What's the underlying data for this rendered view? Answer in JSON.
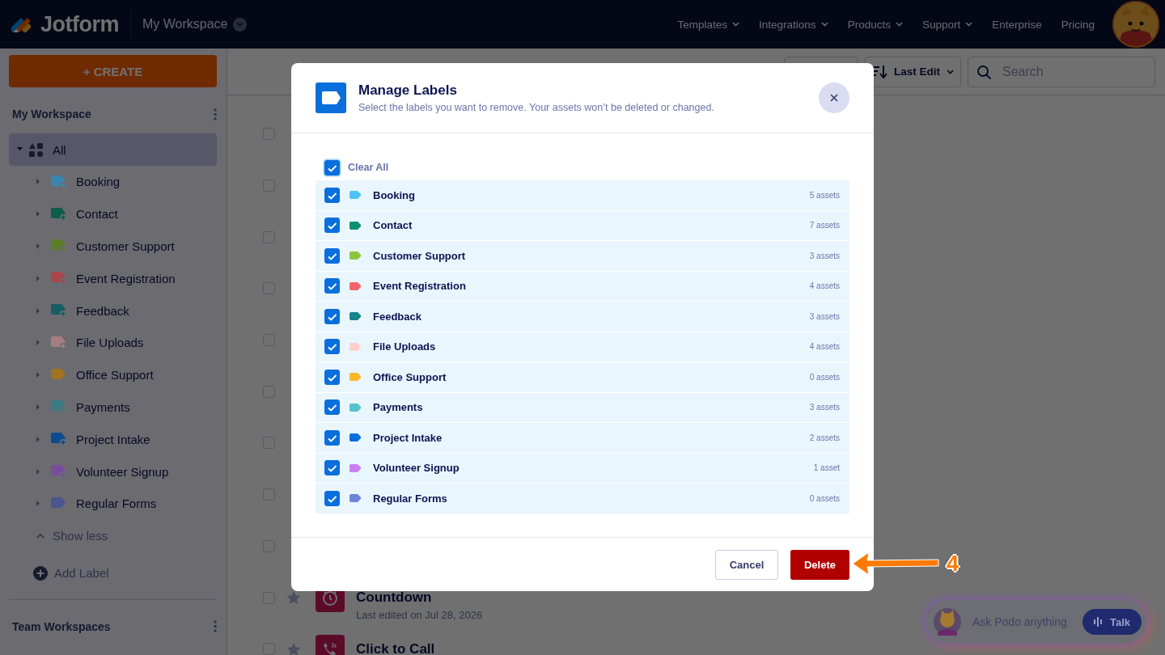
{
  "header": {
    "logo": "Jotform",
    "workspace": "My Workspace",
    "nav": [
      {
        "label": "Templates",
        "dropdown": true
      },
      {
        "label": "Integrations",
        "dropdown": true
      },
      {
        "label": "Products",
        "dropdown": true
      },
      {
        "label": "Support",
        "dropdown": true
      },
      {
        "label": "Enterprise",
        "dropdown": false
      },
      {
        "label": "Pricing",
        "dropdown": false
      }
    ]
  },
  "sidebar": {
    "create_button": "+ CREATE",
    "section_title": "My Workspace",
    "all_item": {
      "label": "All",
      "selected": true,
      "expanded": true
    },
    "labels": [
      {
        "name": "Booking",
        "color": "#3a86b0",
        "shared": true,
        "selected": false
      },
      {
        "name": "Contact",
        "color": "#0d5e48",
        "shared": true,
        "selected": false
      },
      {
        "name": "Customer Support",
        "color": "#5b7e26",
        "shared": true,
        "selected": false
      },
      {
        "name": "Event Registration",
        "color": "#a8464c",
        "shared": true,
        "selected": false
      },
      {
        "name": "Feedback",
        "color": "#155e62",
        "shared": true,
        "selected": false
      },
      {
        "name": "File Uploads",
        "color": "#a37e80",
        "shared": true,
        "selected": false
      },
      {
        "name": "Office Support",
        "color": "#9e7420",
        "shared": false,
        "selected": false
      },
      {
        "name": "Payments",
        "color": "#3a7c82",
        "shared": true,
        "selected": false
      },
      {
        "name": "Project Intake",
        "color": "#0c4c8e",
        "shared": true,
        "selected": false
      },
      {
        "name": "Volunteer Signup",
        "color": "#7a4c9c",
        "shared": true,
        "selected": false
      },
      {
        "name": "Regular Forms",
        "color": "#4a5690",
        "shared": false,
        "selected": false
      }
    ],
    "show_less": "Show less",
    "add_label": "Add Label",
    "team_section_title": "Team Workspaces"
  },
  "toolbar": {
    "sort_button": "Last Edit",
    "search": {
      "placeholder": "Search"
    }
  },
  "forms": [
    {
      "checked": false
    },
    {
      "checked": false
    },
    {
      "checked": false
    },
    {
      "checked": false
    },
    {
      "checked": false
    },
    {
      "checked": false
    },
    {
      "checked": false
    },
    {
      "checked": false
    },
    {
      "checked": false
    },
    {
      "checked": false,
      "starred": false,
      "kind": "timer",
      "title": "Countdown",
      "subtitle": "Last edited on Jul 28, 2026"
    },
    {
      "checked": false,
      "starred": false,
      "kind": "phone",
      "title": "Click to Call"
    }
  ],
  "modal": {
    "title": "Manage Labels",
    "subtitle": "Select the labels you want to remove. Your assets won’t be deleted or changed.",
    "clear_all": {
      "label": "Clear All",
      "checked": true
    },
    "labels": [
      {
        "name": "Booking",
        "color": "#4fc3f7",
        "count": "5 assets",
        "checked": true
      },
      {
        "name": "Contact",
        "color": "#0f8f6c",
        "count": "7 assets",
        "checked": true
      },
      {
        "name": "Customer Support",
        "color": "#8cc63f",
        "count": "3 assets",
        "checked": true
      },
      {
        "name": "Event Registration",
        "color": "#f4646b",
        "count": "4 assets",
        "checked": true
      },
      {
        "name": "Feedback",
        "color": "#17858a",
        "count": "3 assets",
        "checked": true
      },
      {
        "name": "File Uploads",
        "color": "#fdd0cf",
        "count": "4 assets",
        "checked": true
      },
      {
        "name": "Office Support",
        "color": "#ffb629",
        "count": "0 assets",
        "checked": true
      },
      {
        "name": "Payments",
        "color": "#55c2cc",
        "count": "3 assets",
        "checked": true
      },
      {
        "name": "Project Intake",
        "color": "#0a6fdc",
        "count": "2 assets",
        "checked": true
      },
      {
        "name": "Volunteer Signup",
        "color": "#c97ef0",
        "count": "1 asset",
        "checked": true
      },
      {
        "name": "Regular Forms",
        "color": "#6e85dc",
        "count": "0 assets",
        "checked": true
      }
    ],
    "cancel_button": "Cancel",
    "delete_button": "Delete"
  },
  "assistant": {
    "placeholder": "Ask Podo anything",
    "talk_button": "Talk"
  },
  "annotation": {
    "label": "4"
  }
}
